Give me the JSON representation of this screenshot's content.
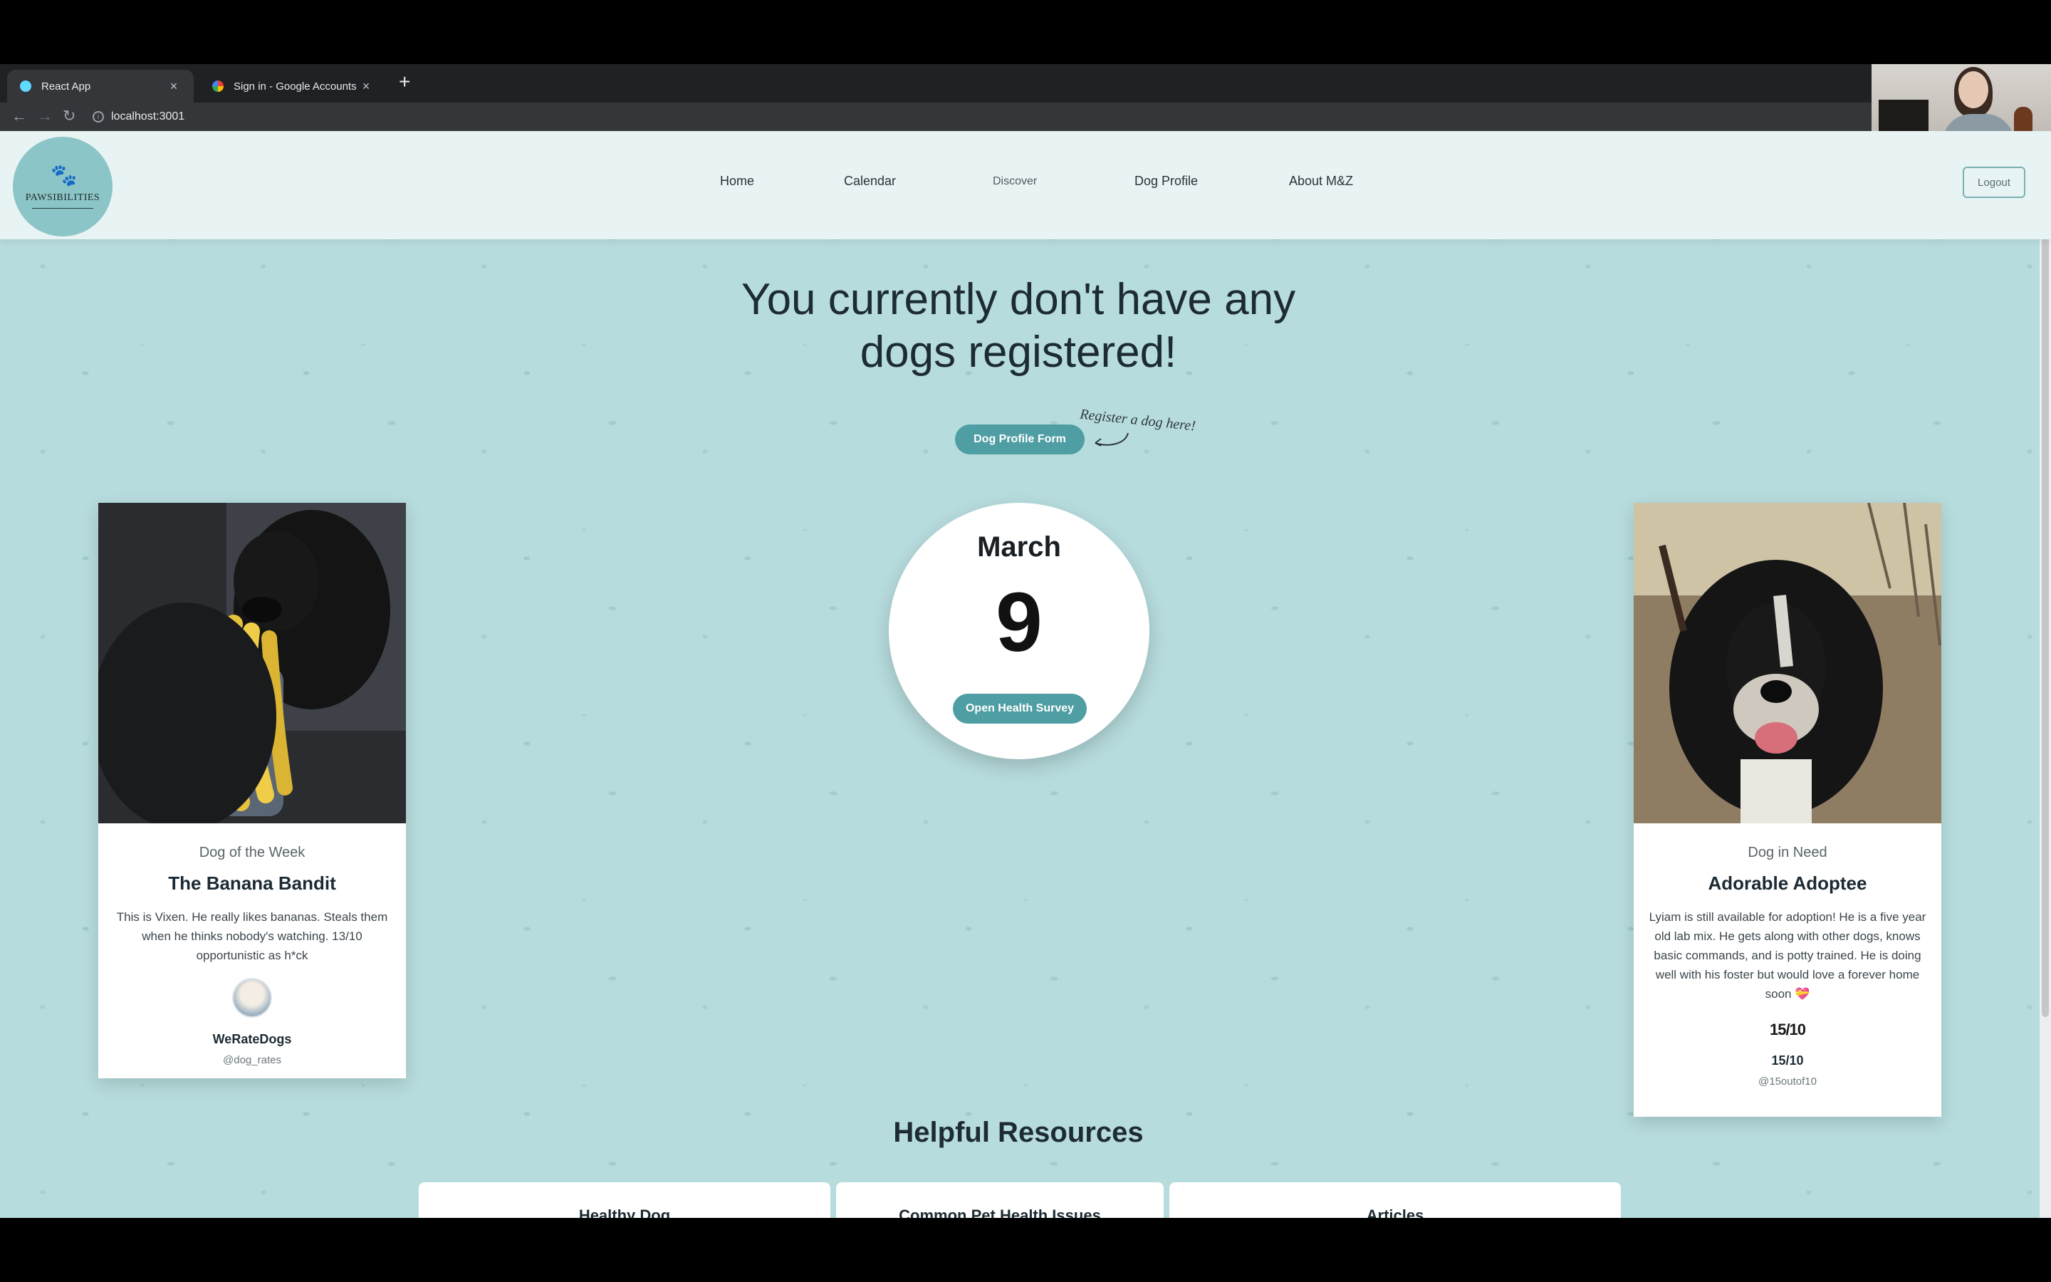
{
  "browser": {
    "tabs": [
      {
        "title": "React App",
        "active": true
      },
      {
        "title": "Sign in - Google Accounts",
        "active": false
      }
    ],
    "url": "localhost:3001"
  },
  "nav": {
    "logo_text": "PAWSIBILITIES",
    "links": [
      "Home",
      "Calendar",
      "Discover",
      "Dog Profile",
      "About M&Z"
    ],
    "logout": "Logout"
  },
  "hero": {
    "headline": "You currently don't have any dogs registered!",
    "profile_button": "Dog Profile Form",
    "register_note": "Register a dog here!"
  },
  "date": {
    "month": "March",
    "day": "9",
    "survey_button": "Open Health Survey"
  },
  "left_card": {
    "eyebrow": "Dog of the Week",
    "title": "The Banana Bandit",
    "description": "This is Vixen. He really likes bananas. Steals them when he thinks nobody's watching. 13/10 opportunistic as h*ck",
    "handle": "WeRateDogs",
    "at": "@dog_rates"
  },
  "right_card": {
    "eyebrow": "Dog in Need",
    "title": "Adorable Adoptee",
    "description": "Lyiam is still available for adoption! He is a five year old lab mix. He gets along with other dogs, knows basic commands, and is potty trained. He is doing well with his foster but would love a forever home soon 💝",
    "rating_logo": "15/10",
    "handle": "15/10",
    "at": "@15outof10"
  },
  "resources": {
    "heading": "Helpful Resources",
    "cards": [
      "Healthy Dog",
      "Common Pet Health Issues",
      "Articles"
    ]
  },
  "colors": {
    "accent": "#4f9ea3",
    "background": "#b7dcdd",
    "nav_background": "#e8f3f3"
  }
}
